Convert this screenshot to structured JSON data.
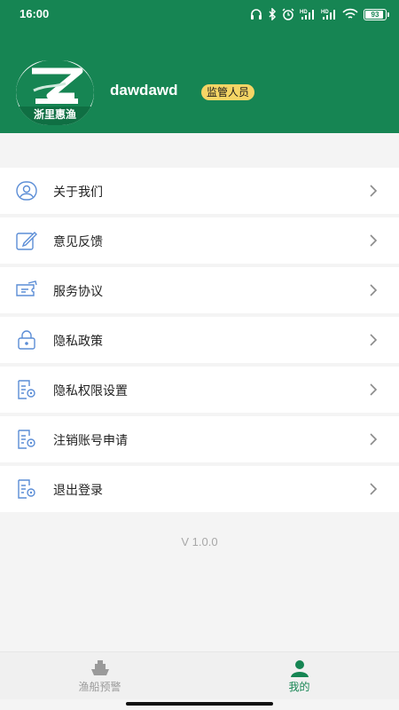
{
  "status_bar": {
    "time": "16:00",
    "battery": "93",
    "battery_level": 0.93,
    "icons": [
      "headphones-icon",
      "bluetooth-icon",
      "alarm-icon",
      "signal-hd-icon",
      "signal-hd-icon",
      "wifi-icon",
      "battery-icon"
    ]
  },
  "profile": {
    "logo_text": "浙里惠渔",
    "username": "dawdawd",
    "role": "监管人员"
  },
  "menu": {
    "items": [
      {
        "label": "关于我们",
        "icon": "person-circle-icon"
      },
      {
        "label": "意见反馈",
        "icon": "edit-icon"
      },
      {
        "label": "服务协议",
        "icon": "ticket-icon"
      },
      {
        "label": "隐私政策",
        "icon": "lock-icon"
      },
      {
        "label": "隐私权限设置",
        "icon": "document-settings-icon"
      },
      {
        "label": "注销账号申请",
        "icon": "document-settings-icon"
      },
      {
        "label": "退出登录",
        "icon": "document-settings-icon"
      }
    ]
  },
  "version": "V 1.0.0",
  "tabbar": {
    "tabs": [
      {
        "label": "渔船预警",
        "icon": "ship-icon",
        "active": false
      },
      {
        "label": "我的",
        "icon": "user-icon",
        "active": true
      }
    ]
  },
  "colors": {
    "brand": "#168553",
    "badge": "#f5d565",
    "tab_inactive": "#9a9a9a",
    "icon_blue": "#5b8dd6"
  }
}
